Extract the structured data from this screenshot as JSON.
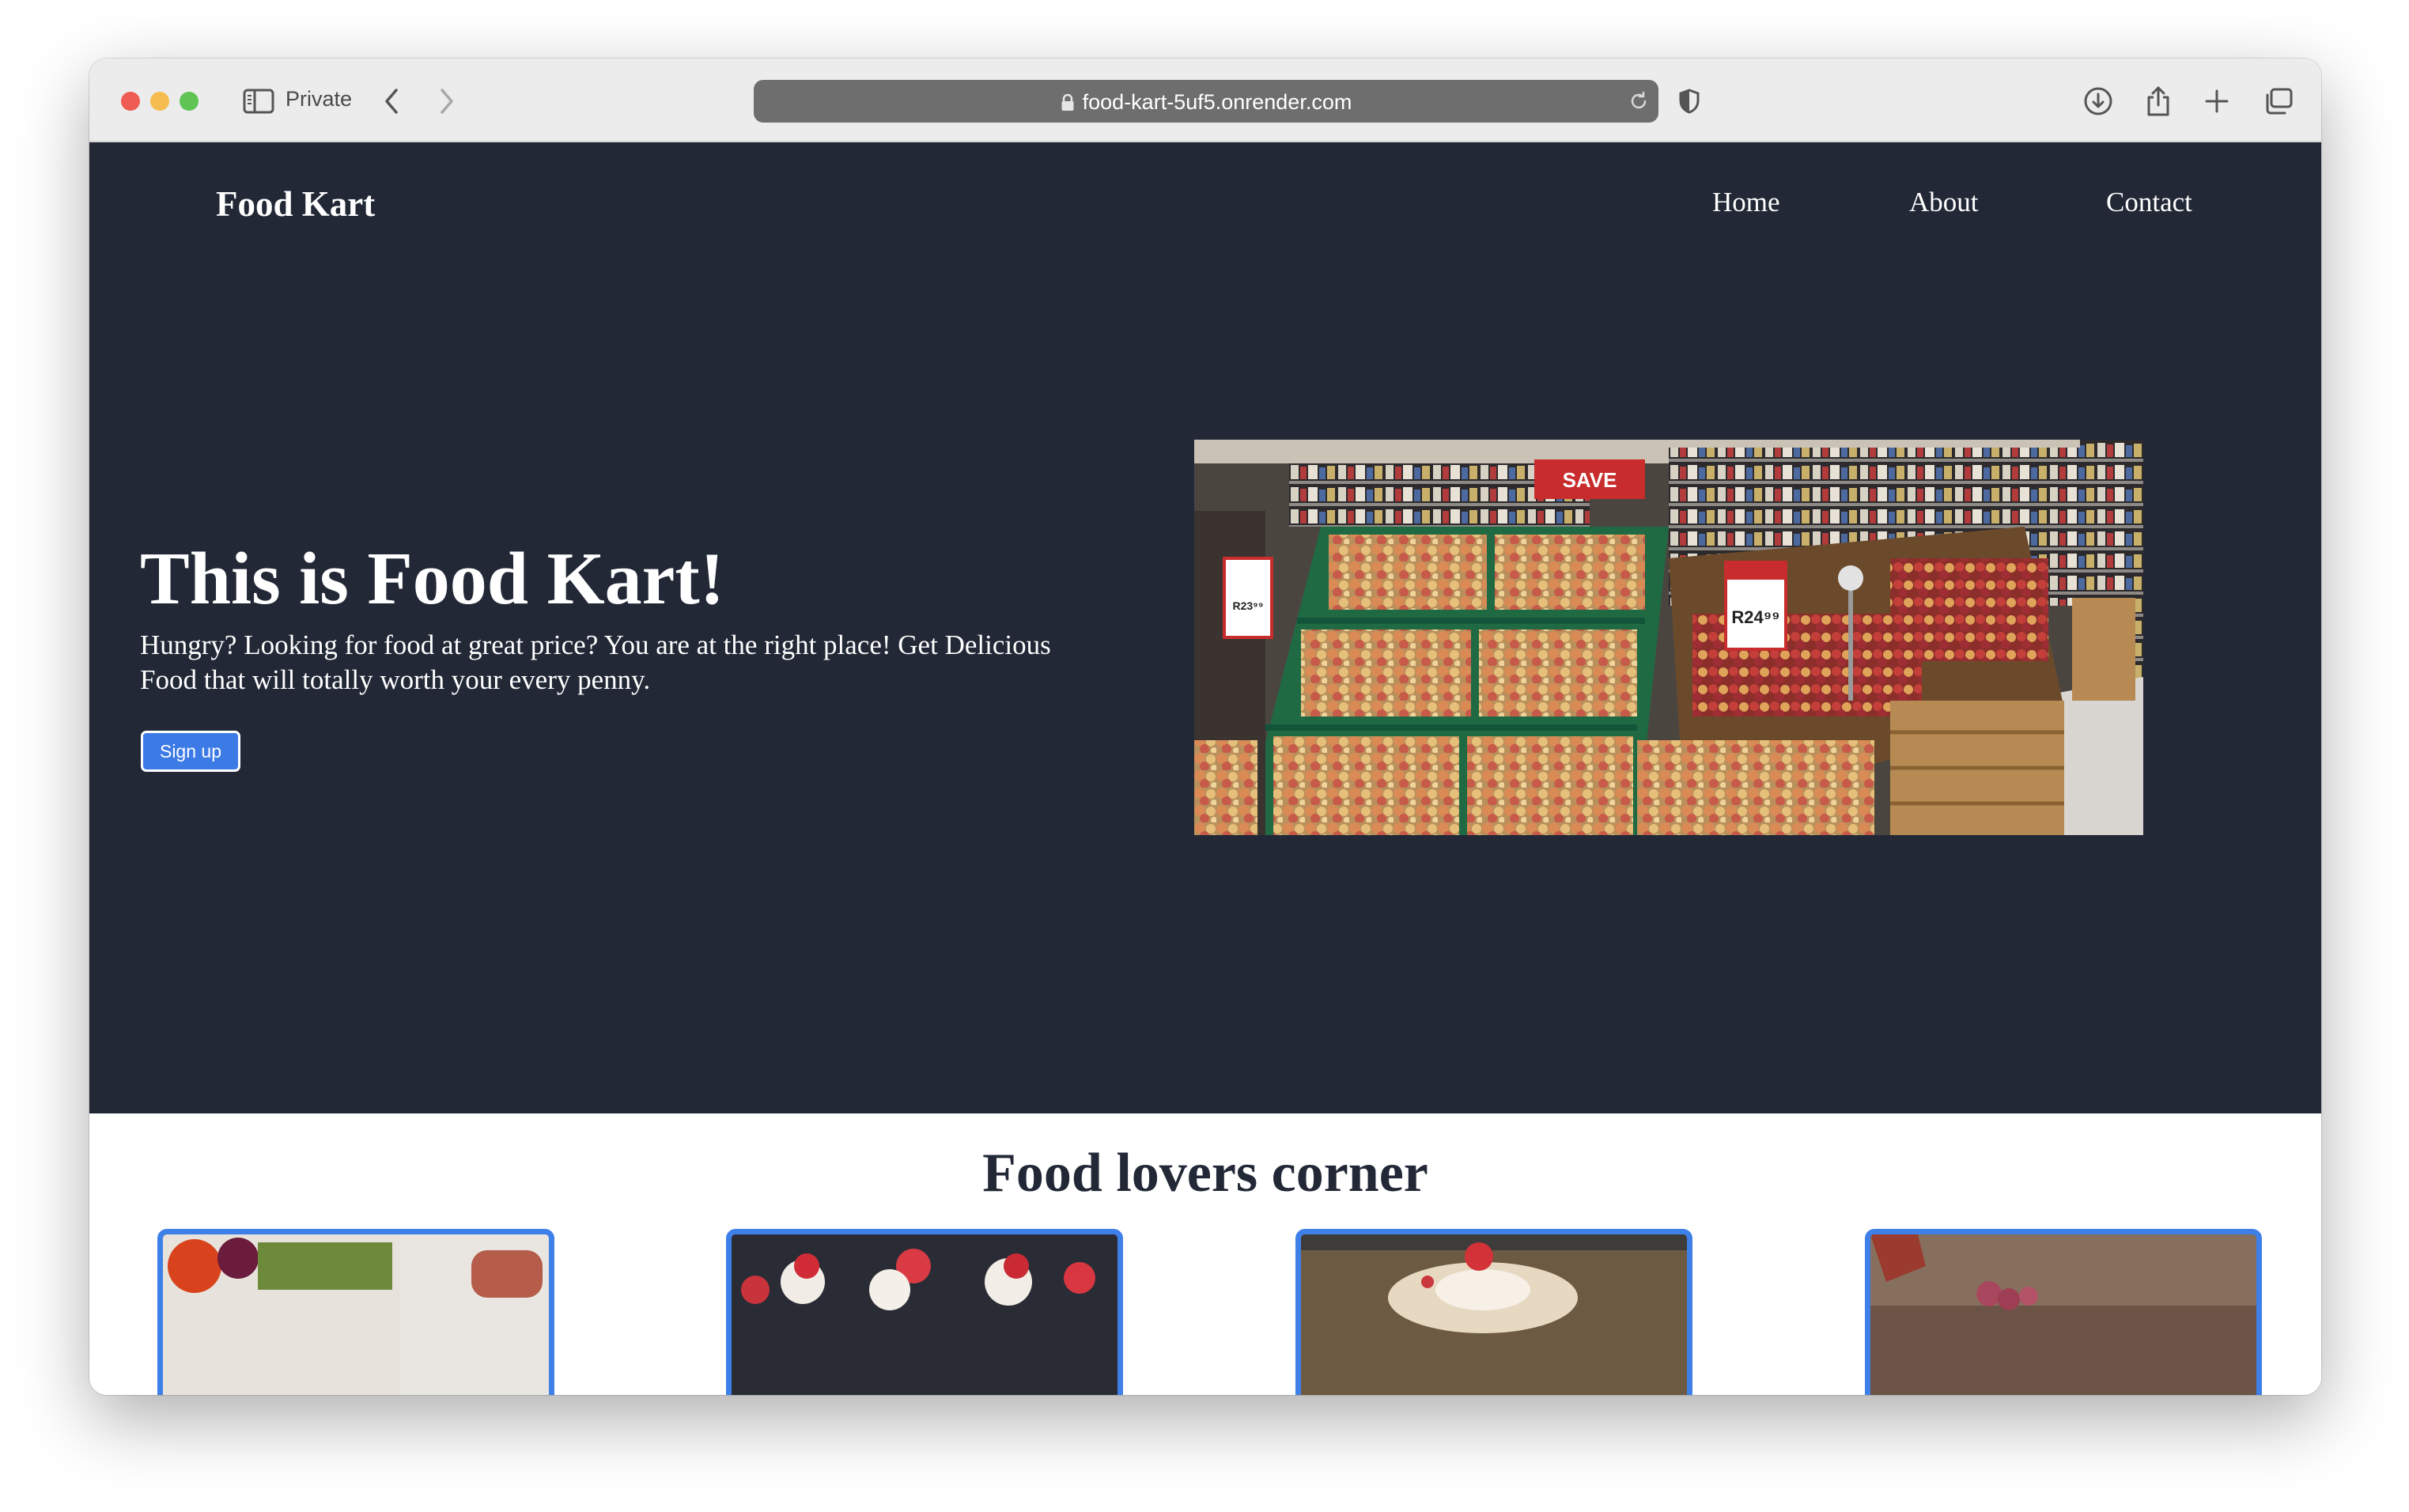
{
  "browser": {
    "mode_label": "Private",
    "url": "food-kart-5uf5.onrender.com"
  },
  "site": {
    "brand": "Food Kart",
    "nav": [
      "Home",
      "About",
      "Contact"
    ],
    "hero": {
      "title": "This is Food Kart!",
      "text": "Hungry? Looking for food at great price? You are at the right place! Get Delicious Food that will totally worth your every penny.",
      "cta": "Sign up",
      "image_signs": [
        "SAVE",
        "R24⁹⁹",
        "R23⁹⁹"
      ]
    },
    "section_title": "Food lovers corner"
  },
  "colors": {
    "hero_bg": "#222836",
    "accent": "#3f7fe8",
    "button": "#3c7ae6"
  },
  "icons": [
    "sidebar-icon",
    "back-icon",
    "forward-icon",
    "page-icon",
    "lock-icon",
    "reload-icon",
    "shield-icon",
    "download-icon",
    "share-icon",
    "new-tab-icon",
    "tabs-overview-icon"
  ]
}
